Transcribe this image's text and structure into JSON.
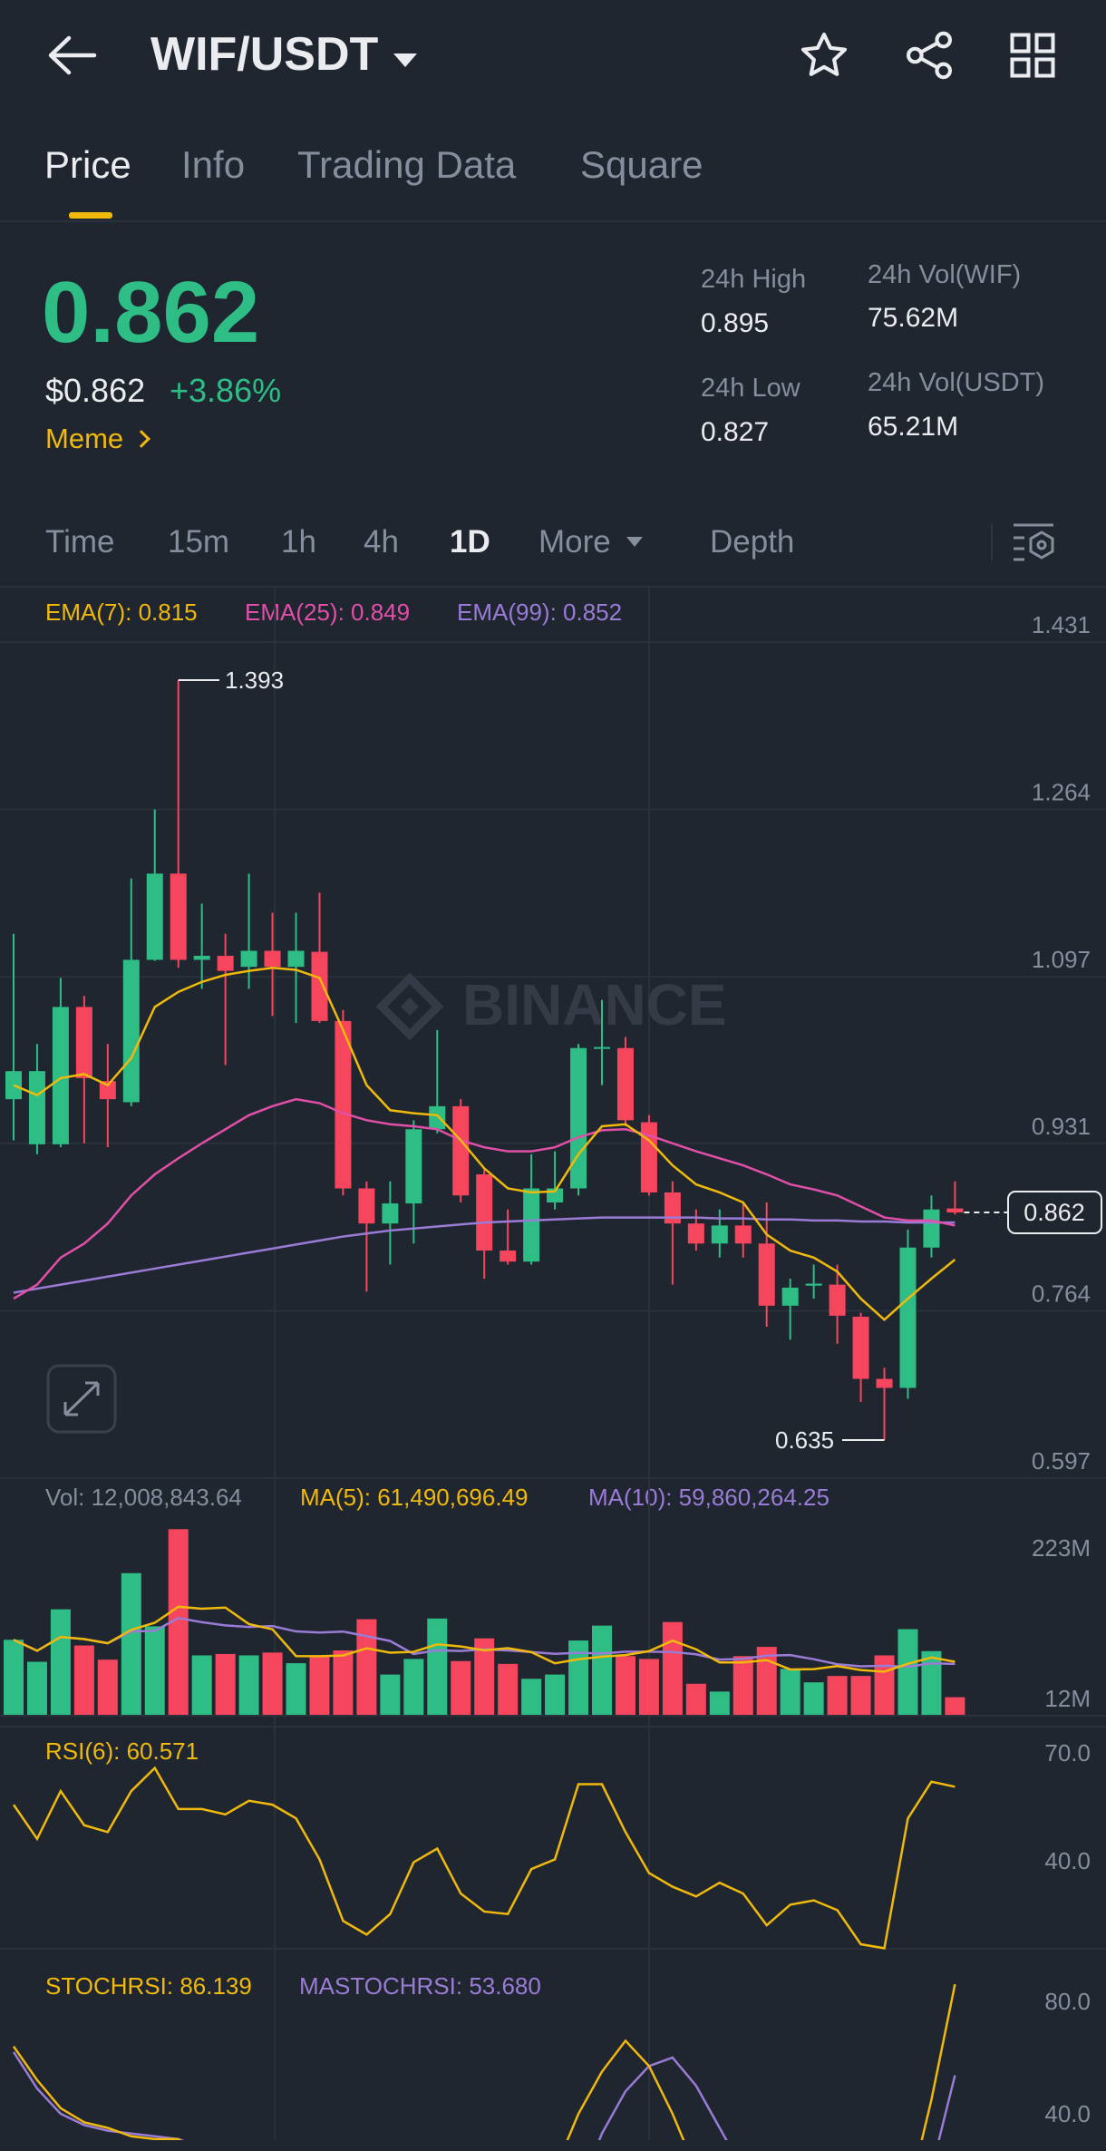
{
  "header": {
    "title": "WIF/USDT",
    "icons": [
      "back-arrow-icon",
      "dropdown-caret-icon",
      "star-icon",
      "share-icon",
      "grid-icon"
    ]
  },
  "tabs": [
    {
      "label": "Price",
      "active": true
    },
    {
      "label": "Info"
    },
    {
      "label": "Trading Data"
    },
    {
      "label": "Square"
    }
  ],
  "ticker": {
    "last_price": "0.862",
    "usd_price": "$0.862",
    "change": "+3.86%",
    "tag": "Meme",
    "stats": {
      "high_label": "24h High",
      "high": "0.895",
      "low_label": "24h Low",
      "low": "0.827",
      "vol_base_label": "24h Vol(WIF)",
      "vol_base": "75.62M",
      "vol_quote_label": "24h Vol(USDT)",
      "vol_quote": "65.21M"
    }
  },
  "intervals": [
    "Time",
    "15m",
    "1h",
    "4h",
    "1D",
    "More",
    "Depth"
  ],
  "active_interval": "1D",
  "colors": {
    "up": "#2ebd85",
    "down": "#f6465d",
    "ema7": "#f0b90b",
    "ema25": "#e24fa8",
    "ema99": "#9a7bd6",
    "accent": "#f0b90b"
  },
  "chart_data": {
    "type": "candlestick",
    "watermark": "BINANCE",
    "legend": {
      "ema7": "EMA(7): 0.815",
      "ema25": "EMA(25): 0.849",
      "ema99": "EMA(99): 0.852"
    },
    "price_axis": [
      "1.431",
      "1.264",
      "1.097",
      "0.931",
      "0.764",
      "0.597"
    ],
    "ylim": [
      0.597,
      1.431
    ],
    "current_price": "0.862",
    "max_label": "1.393",
    "min_label": "0.635",
    "candles": [
      [
        0.975,
        1.14,
        0.934,
        1.003
      ],
      [
        0.93,
        1.03,
        0.92,
        1.003
      ],
      [
        0.93,
        1.096,
        0.927,
        1.067
      ],
      [
        1.067,
        1.078,
        0.931,
        0.996
      ],
      [
        0.993,
        1.03,
        0.927,
        0.975
      ],
      [
        0.972,
        1.195,
        0.968,
        1.114
      ],
      [
        1.114,
        1.264,
        1.113,
        1.2
      ],
      [
        1.2,
        1.393,
        1.106,
        1.114
      ],
      [
        1.114,
        1.17,
        1.085,
        1.118
      ],
      [
        1.118,
        1.14,
        1.009,
        1.103
      ],
      [
        1.107,
        1.2,
        1.085,
        1.123
      ],
      [
        1.123,
        1.161,
        1.058,
        1.107
      ],
      [
        1.107,
        1.161,
        1.051,
        1.123
      ],
      [
        1.122,
        1.181,
        1.051,
        1.053
      ],
      [
        1.053,
        1.064,
        0.879,
        0.886
      ],
      [
        0.886,
        0.893,
        0.783,
        0.851
      ],
      [
        0.851,
        0.893,
        0.81,
        0.871
      ],
      [
        0.871,
        0.954,
        0.831,
        0.945
      ],
      [
        0.945,
        1.044,
        0.941,
        0.968
      ],
      [
        0.968,
        0.975,
        0.872,
        0.879
      ],
      [
        0.9,
        0.906,
        0.796,
        0.824
      ],
      [
        0.824,
        0.865,
        0.81,
        0.813
      ],
      [
        0.813,
        0.92,
        0.81,
        0.886
      ],
      [
        0.872,
        0.923,
        0.865,
        0.886
      ],
      [
        0.886,
        1.03,
        0.879,
        1.026
      ],
      [
        1.026,
        1.074,
        0.989,
        1.027
      ],
      [
        1.026,
        1.037,
        0.948,
        0.954
      ],
      [
        0.952,
        0.959,
        0.879,
        0.882
      ],
      [
        0.882,
        0.893,
        0.79,
        0.851
      ],
      [
        0.851,
        0.865,
        0.824,
        0.831
      ],
      [
        0.831,
        0.865,
        0.817,
        0.849
      ],
      [
        0.849,
        0.872,
        0.817,
        0.831
      ],
      [
        0.831,
        0.872,
        0.748,
        0.769
      ],
      [
        0.769,
        0.796,
        0.735,
        0.787
      ],
      [
        0.789,
        0.81,
        0.776,
        0.791
      ],
      [
        0.79,
        0.81,
        0.731,
        0.759
      ],
      [
        0.758,
        0.762,
        0.673,
        0.696
      ],
      [
        0.696,
        0.707,
        0.635,
        0.687
      ],
      [
        0.687,
        0.845,
        0.676,
        0.827
      ],
      [
        0.827,
        0.879,
        0.817,
        0.865
      ],
      [
        0.866,
        0.893,
        0.86,
        0.862
      ]
    ],
    "ema7": [
      0.989,
      0.979,
      0.996,
      1.0,
      0.989,
      1.016,
      1.067,
      1.082,
      1.092,
      1.099,
      1.103,
      1.106,
      1.104,
      1.096,
      1.044,
      0.989,
      0.964,
      0.961,
      0.959,
      0.934,
      0.906,
      0.886,
      0.882,
      0.883,
      0.92,
      0.948,
      0.95,
      0.934,
      0.909,
      0.89,
      0.882,
      0.872,
      0.84,
      0.824,
      0.817,
      0.803,
      0.776,
      0.755,
      0.776,
      0.796,
      0.815
    ],
    "ema25": [
      0.776,
      0.79,
      0.817,
      0.831,
      0.851,
      0.879,
      0.9,
      0.916,
      0.931,
      0.945,
      0.959,
      0.968,
      0.975,
      0.971,
      0.961,
      0.954,
      0.95,
      0.948,
      0.945,
      0.934,
      0.927,
      0.923,
      0.923,
      0.927,
      0.937,
      0.944,
      0.945,
      0.939,
      0.931,
      0.923,
      0.916,
      0.909,
      0.9,
      0.89,
      0.885,
      0.879,
      0.868,
      0.857,
      0.854,
      0.854,
      0.849
    ],
    "ema99": [
      0.782,
      0.786,
      0.79,
      0.794,
      0.798,
      0.802,
      0.806,
      0.81,
      0.814,
      0.818,
      0.822,
      0.826,
      0.83,
      0.834,
      0.838,
      0.841,
      0.844,
      0.846,
      0.848,
      0.85,
      0.852,
      0.853,
      0.854,
      0.855,
      0.856,
      0.857,
      0.857,
      0.857,
      0.857,
      0.857,
      0.856,
      0.856,
      0.855,
      0.855,
      0.854,
      0.854,
      0.853,
      0.853,
      0.852,
      0.852,
      0.852
    ],
    "volume": {
      "legend": {
        "vol": "Vol: 12,008,843.64",
        "ma5": "MA(5): 61,490,696.49",
        "ma10": "MA(10): 59,860,264.25"
      },
      "axis": [
        "223M",
        "12M"
      ],
      "values_m": [
        93,
        62,
        136,
        85,
        65,
        187,
        112,
        249,
        71,
        73,
        71,
        75,
        60,
        70,
        78,
        122,
        44,
        66,
        123,
        63,
        95,
        59,
        38,
        44,
        92,
        113,
        70,
        66,
        118,
        31,
        20,
        70,
        83,
        52,
        33,
        42,
        42,
        71,
        108,
        77,
        12
      ]
    },
    "rsi": {
      "legend": "RSI(6): 60.571",
      "axis": [
        "70.0",
        "40.0"
      ],
      "values": [
        55.6,
        46.1,
        59.4,
        49.9,
        48.0,
        59.4,
        65.8,
        54.4,
        54.4,
        52.9,
        56.7,
        55.6,
        51.8,
        40.4,
        23.3,
        19.5,
        25.2,
        39.6,
        43.4,
        30.9,
        25.9,
        25.2,
        37.7,
        40.4,
        61.3,
        61.3,
        48.0,
        36.6,
        32.8,
        30.1,
        33.9,
        30.9,
        22.1,
        27.8,
        29.0,
        26.3,
        16.8,
        15.7,
        51.8,
        62.0,
        60.6
      ]
    },
    "stochrsi": {
      "legend_k": "STOCHRSI: 86.139",
      "legend_d": "MASTOCHRSI: 53.680",
      "axis": [
        "80.0",
        "40.0"
      ],
      "k": [
        64,
        52,
        42,
        37,
        35,
        32,
        31,
        31,
        25,
        15,
        10,
        5,
        5,
        3,
        0,
        0,
        0,
        0,
        5,
        10,
        5,
        0,
        0,
        20,
        40,
        55,
        66,
        57,
        40,
        20,
        5,
        0,
        0,
        0,
        0,
        0,
        0,
        0,
        10,
        45,
        86.1
      ],
      "d": [
        62,
        49,
        40,
        36,
        34,
        33,
        32,
        31,
        28,
        22,
        15,
        10,
        6,
        4,
        2,
        1,
        0,
        0,
        2,
        5,
        6,
        4,
        2,
        1,
        12,
        33,
        48,
        57,
        60,
        50,
        35,
        20,
        8,
        2,
        0,
        0,
        0,
        0,
        3,
        20,
        53.7
      ]
    }
  }
}
